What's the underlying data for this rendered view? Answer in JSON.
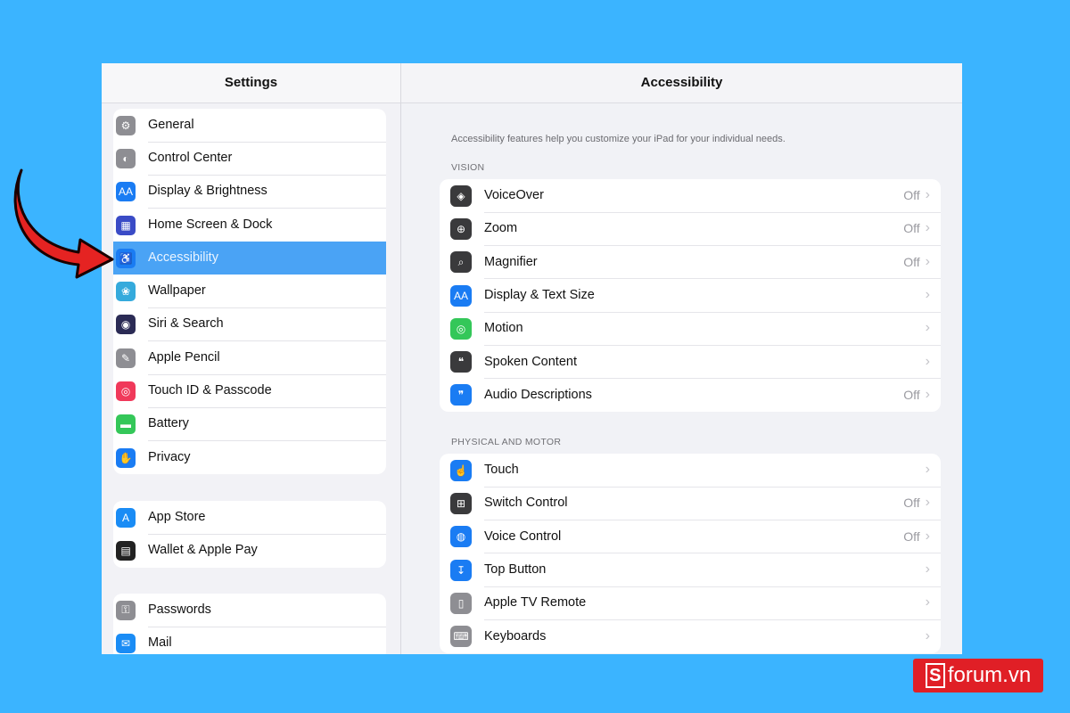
{
  "sidebar": {
    "title": "Settings",
    "groups": [
      [
        {
          "label": "General",
          "icon": "gear-icon",
          "color": "#8e8e93",
          "glyph": "⚙"
        },
        {
          "label": "Control Center",
          "icon": "control-center-icon",
          "color": "#8e8e93",
          "glyph": "◐"
        },
        {
          "label": "Display & Brightness",
          "icon": "display-icon",
          "color": "#1a7cf3",
          "glyph": "AA"
        },
        {
          "label": "Home Screen & Dock",
          "icon": "home-screen-icon",
          "color": "#3a4bc6",
          "glyph": "▦"
        },
        {
          "label": "Accessibility",
          "icon": "accessibility-icon",
          "color": "#1a7cf3",
          "glyph": "♿",
          "selected": true
        },
        {
          "label": "Wallpaper",
          "icon": "wallpaper-icon",
          "color": "#35aadc",
          "glyph": "❀"
        },
        {
          "label": "Siri & Search",
          "icon": "siri-icon",
          "color": "#2b2b55",
          "glyph": "◉"
        },
        {
          "label": "Apple Pencil",
          "icon": "pencil-icon",
          "color": "#8e8e93",
          "glyph": "✎"
        },
        {
          "label": "Touch ID & Passcode",
          "icon": "fingerprint-icon",
          "color": "#f0395a",
          "glyph": "◎"
        },
        {
          "label": "Battery",
          "icon": "battery-icon",
          "color": "#34c759",
          "glyph": "▬"
        },
        {
          "label": "Privacy",
          "icon": "hand-icon",
          "color": "#1a7cf3",
          "glyph": "✋"
        }
      ],
      [
        {
          "label": "App Store",
          "icon": "app-store-icon",
          "color": "#1a8cf5",
          "glyph": "A"
        },
        {
          "label": "Wallet & Apple Pay",
          "icon": "wallet-icon",
          "color": "#222222",
          "glyph": "▤"
        }
      ],
      [
        {
          "label": "Passwords",
          "icon": "key-icon",
          "color": "#8e8e93",
          "glyph": "⚿"
        },
        {
          "label": "Mail",
          "icon": "mail-icon",
          "color": "#1a8cf5",
          "glyph": "✉"
        }
      ]
    ]
  },
  "main": {
    "title": "Accessibility",
    "description": "Accessibility features help you customize your iPad for your individual needs.",
    "sections": [
      {
        "title": "VISION",
        "items": [
          {
            "label": "VoiceOver",
            "status": "Off",
            "icon": "voiceover-icon",
            "color": "#3a3a3c",
            "glyph": "◈"
          },
          {
            "label": "Zoom",
            "status": "Off",
            "icon": "zoom-icon",
            "color": "#3a3a3c",
            "glyph": "⊕"
          },
          {
            "label": "Magnifier",
            "status": "Off",
            "icon": "magnifier-icon",
            "color": "#3a3a3c",
            "glyph": "⌕"
          },
          {
            "label": "Display & Text Size",
            "status": "",
            "icon": "text-size-icon",
            "color": "#1a7cf3",
            "glyph": "AA"
          },
          {
            "label": "Motion",
            "status": "",
            "icon": "motion-icon",
            "color": "#34c759",
            "glyph": "◎"
          },
          {
            "label": "Spoken Content",
            "status": "",
            "icon": "spoken-content-icon",
            "color": "#3a3a3c",
            "glyph": "❝"
          },
          {
            "label": "Audio Descriptions",
            "status": "Off",
            "icon": "audio-descriptions-icon",
            "color": "#1a7cf3",
            "glyph": "❞"
          }
        ]
      },
      {
        "title": "PHYSICAL AND MOTOR",
        "items": [
          {
            "label": "Touch",
            "status": "",
            "icon": "touch-icon",
            "color": "#1a7cf3",
            "glyph": "☝"
          },
          {
            "label": "Switch Control",
            "status": "Off",
            "icon": "switch-control-icon",
            "color": "#3a3a3c",
            "glyph": "⊞"
          },
          {
            "label": "Voice Control",
            "status": "Off",
            "icon": "voice-control-icon",
            "color": "#1a7cf3",
            "glyph": "◍"
          },
          {
            "label": "Top Button",
            "status": "",
            "icon": "top-button-icon",
            "color": "#1a7cf3",
            "glyph": "↧"
          },
          {
            "label": "Apple TV Remote",
            "status": "",
            "icon": "tv-remote-icon",
            "color": "#8e8e93",
            "glyph": "▯"
          },
          {
            "label": "Keyboards",
            "status": "",
            "icon": "keyboard-icon",
            "color": "#8e8e93",
            "glyph": "⌨"
          }
        ]
      }
    ]
  },
  "watermark": {
    "letter": "S",
    "text": "forum.vn"
  }
}
